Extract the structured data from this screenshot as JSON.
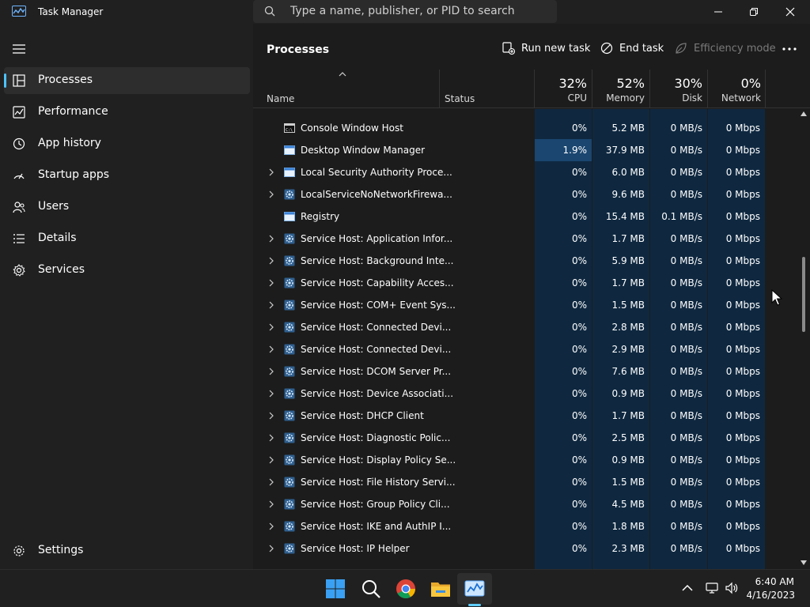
{
  "window": {
    "title": "Task Manager",
    "search_placeholder": "Type a name, publisher, or PID to search"
  },
  "sidebar": {
    "items": [
      {
        "label": "Processes",
        "icon": "processes-icon",
        "active": true
      },
      {
        "label": "Performance",
        "icon": "performance-icon"
      },
      {
        "label": "App history",
        "icon": "app-history-icon"
      },
      {
        "label": "Startup apps",
        "icon": "startup-apps-icon"
      },
      {
        "label": "Users",
        "icon": "users-icon"
      },
      {
        "label": "Details",
        "icon": "details-icon"
      },
      {
        "label": "Services",
        "icon": "services-icon"
      }
    ],
    "settings_label": "Settings"
  },
  "toolbar": {
    "title": "Processes",
    "run_new_task": "Run new task",
    "end_task": "End task",
    "efficiency_mode": "Efficiency mode"
  },
  "columns": {
    "name": "Name",
    "status": "Status",
    "cpu_pct": "32%",
    "cpu": "CPU",
    "memory_pct": "52%",
    "memory": "Memory",
    "disk_pct": "30%",
    "disk": "Disk",
    "network_pct": "0%",
    "network": "Network"
  },
  "processes": [
    {
      "name": "Console Window Host",
      "cpu": "0%",
      "mem": "5.2 MB",
      "disk": "0 MB/s",
      "net": "0 Mbps",
      "expandable": false,
      "icon": "console-icon"
    },
    {
      "name": "Desktop Window Manager",
      "cpu": "1.9%",
      "mem": "37.9 MB",
      "disk": "0 MB/s",
      "net": "0 Mbps",
      "expandable": false,
      "icon": "window-icon",
      "highlight": true
    },
    {
      "name": "Local Security Authority Proce...",
      "cpu": "0%",
      "mem": "6.0 MB",
      "disk": "0 MB/s",
      "net": "0 Mbps",
      "expandable": true,
      "icon": "window-icon"
    },
    {
      "name": "LocalServiceNoNetworkFirewa...",
      "cpu": "0%",
      "mem": "9.6 MB",
      "disk": "0 MB/s",
      "net": "0 Mbps",
      "expandable": true,
      "icon": "gear-icon"
    },
    {
      "name": "Registry",
      "cpu": "0%",
      "mem": "15.4 MB",
      "disk": "0.1 MB/s",
      "net": "0 Mbps",
      "expandable": false,
      "icon": "window-icon"
    },
    {
      "name": "Service Host: Application Infor...",
      "cpu": "0%",
      "mem": "1.7 MB",
      "disk": "0 MB/s",
      "net": "0 Mbps",
      "expandable": true,
      "icon": "gear-icon"
    },
    {
      "name": "Service Host: Background Inte...",
      "cpu": "0%",
      "mem": "5.9 MB",
      "disk": "0 MB/s",
      "net": "0 Mbps",
      "expandable": true,
      "icon": "gear-icon"
    },
    {
      "name": "Service Host: Capability Acces...",
      "cpu": "0%",
      "mem": "1.7 MB",
      "disk": "0 MB/s",
      "net": "0 Mbps",
      "expandable": true,
      "icon": "gear-icon"
    },
    {
      "name": "Service Host: COM+ Event Sys...",
      "cpu": "0%",
      "mem": "1.5 MB",
      "disk": "0 MB/s",
      "net": "0 Mbps",
      "expandable": true,
      "icon": "gear-icon"
    },
    {
      "name": "Service Host: Connected Devi...",
      "cpu": "0%",
      "mem": "2.8 MB",
      "disk": "0 MB/s",
      "net": "0 Mbps",
      "expandable": true,
      "icon": "gear-icon"
    },
    {
      "name": "Service Host: Connected Devi...",
      "cpu": "0%",
      "mem": "2.9 MB",
      "disk": "0 MB/s",
      "net": "0 Mbps",
      "expandable": true,
      "icon": "gear-icon"
    },
    {
      "name": "Service Host: DCOM Server Pr...",
      "cpu": "0%",
      "mem": "7.6 MB",
      "disk": "0 MB/s",
      "net": "0 Mbps",
      "expandable": true,
      "icon": "gear-icon"
    },
    {
      "name": "Service Host: Device Associati...",
      "cpu": "0%",
      "mem": "0.9 MB",
      "disk": "0 MB/s",
      "net": "0 Mbps",
      "expandable": true,
      "icon": "gear-icon"
    },
    {
      "name": "Service Host: DHCP Client",
      "cpu": "0%",
      "mem": "1.7 MB",
      "disk": "0 MB/s",
      "net": "0 Mbps",
      "expandable": true,
      "icon": "gear-icon"
    },
    {
      "name": "Service Host: Diagnostic Polic...",
      "cpu": "0%",
      "mem": "2.5 MB",
      "disk": "0 MB/s",
      "net": "0 Mbps",
      "expandable": true,
      "icon": "gear-icon"
    },
    {
      "name": "Service Host: Display Policy Se...",
      "cpu": "0%",
      "mem": "0.9 MB",
      "disk": "0 MB/s",
      "net": "0 Mbps",
      "expandable": true,
      "icon": "gear-icon"
    },
    {
      "name": "Service Host: File History Servi...",
      "cpu": "0%",
      "mem": "1.5 MB",
      "disk": "0 MB/s",
      "net": "0 Mbps",
      "expandable": true,
      "icon": "gear-icon"
    },
    {
      "name": "Service Host: Group Policy Cli...",
      "cpu": "0%",
      "mem": "4.5 MB",
      "disk": "0 MB/s",
      "net": "0 Mbps",
      "expandable": true,
      "icon": "gear-icon"
    },
    {
      "name": "Service Host: IKE and AuthIP I...",
      "cpu": "0%",
      "mem": "1.8 MB",
      "disk": "0 MB/s",
      "net": "0 Mbps",
      "expandable": true,
      "icon": "gear-icon"
    },
    {
      "name": "Service Host: IP Helper",
      "cpu": "0%",
      "mem": "2.3 MB",
      "disk": "0 MB/s",
      "net": "0 Mbps",
      "expandable": true,
      "icon": "gear-icon"
    }
  ],
  "taskbar": {
    "time": "6:40 AM",
    "date": "4/16/2023"
  },
  "colors": {
    "accent": "#4cc2ff",
    "heat_low": "#0f2840",
    "heat_high": "#1a4670"
  }
}
